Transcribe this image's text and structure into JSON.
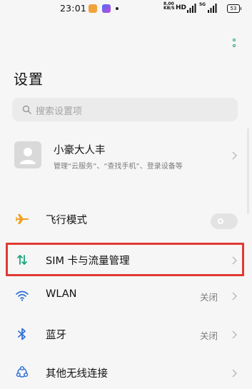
{
  "status_bar": {
    "time": "23:01",
    "net_speed_value": "8.00",
    "net_speed_unit": "KB/S",
    "hd_label": "HD",
    "signal2_label": "5G",
    "battery": "53"
  },
  "header": {
    "title": "设置"
  },
  "search": {
    "placeholder": "搜索设置项"
  },
  "account": {
    "name": "小豪大人丰",
    "description": "管理“云服务”、“查找手机”、登录设备等"
  },
  "settings": {
    "airplane": {
      "label": "飞行模式",
      "enabled": false,
      "icon": "airplane-icon"
    },
    "sim": {
      "label": "SIM 卡与流量管理",
      "icon": "sim-data-icon"
    },
    "wlan": {
      "label": "WLAN",
      "value": "关闭",
      "icon": "wifi-icon"
    },
    "bluetooth": {
      "label": "蓝牙",
      "value": "关闭",
      "icon": "bluetooth-icon"
    },
    "other_wireless": {
      "label": "其他无线连接",
      "icon": "wireless-icon"
    }
  },
  "colors": {
    "accent": "#1fa37a",
    "airplane_icon": "#f0a020",
    "highlight_box": "#e03a33",
    "bluetooth_icon": "#2c6fd6"
  }
}
